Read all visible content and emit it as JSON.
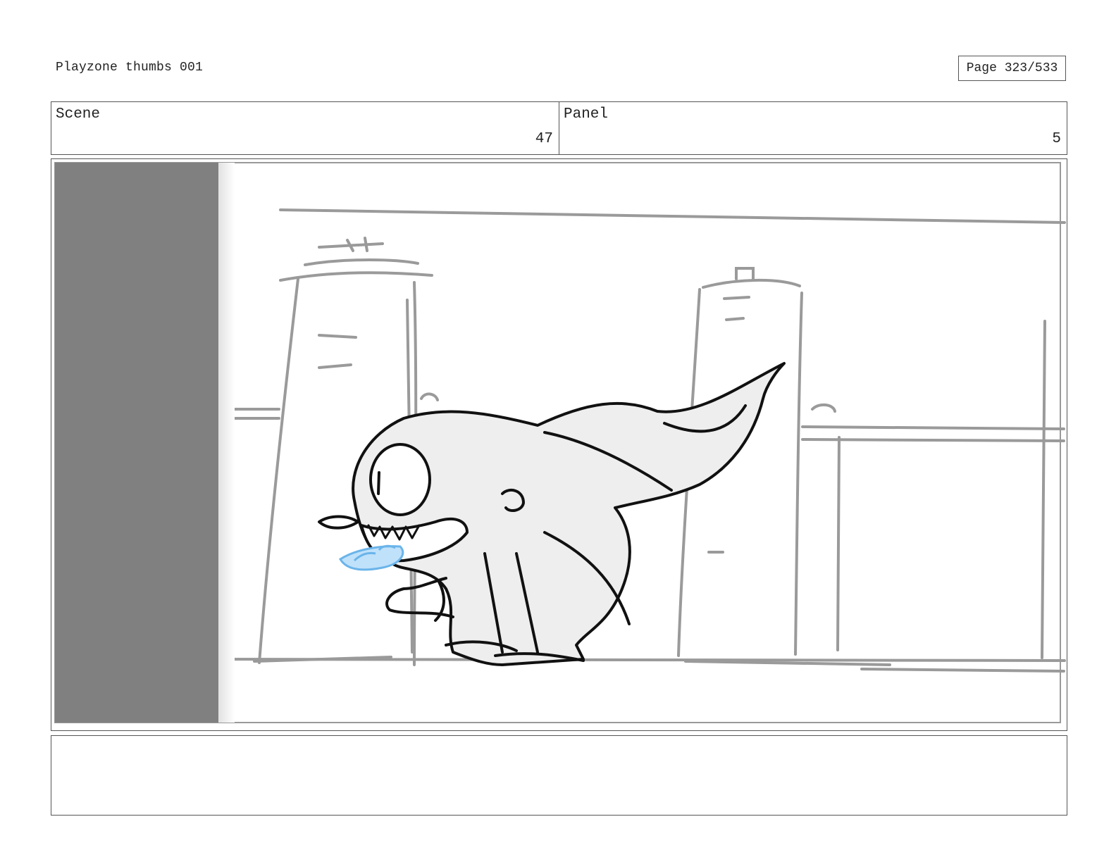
{
  "header": {
    "title": "Playzone thumbs 001",
    "page_label": "Page 323/533"
  },
  "info": {
    "scene_label": "Scene",
    "scene_value": "47",
    "panel_label": "Panel",
    "panel_value": "5"
  },
  "panel_image": {
    "subject": "creature-sketch",
    "colors": {
      "wall": "#808080",
      "line": "#111111",
      "background_line": "#9a9a9a",
      "fill": "#eeeeee",
      "tongue": "#6ab4ea"
    }
  },
  "notes": {
    "text": ""
  }
}
